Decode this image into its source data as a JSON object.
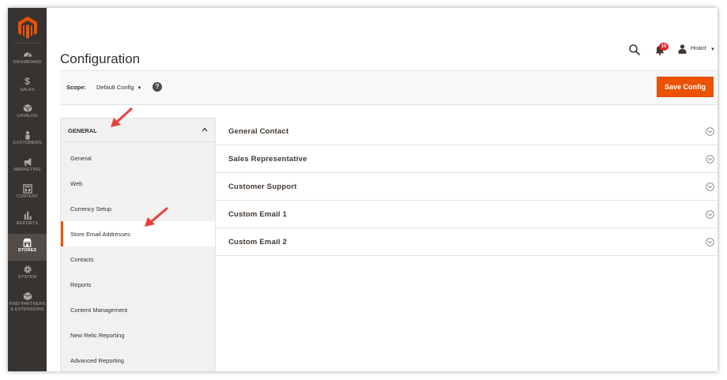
{
  "nav": {
    "items": [
      {
        "label": "Dashboard",
        "icon": "dashboard-icon"
      },
      {
        "label": "Sales",
        "icon": "dollar-icon"
      },
      {
        "label": "Catalog",
        "icon": "cube-icon"
      },
      {
        "label": "Customers",
        "icon": "person-icon"
      },
      {
        "label": "Marketing",
        "icon": "megaphone-icon"
      },
      {
        "label": "Content",
        "icon": "layout-icon"
      },
      {
        "label": "Reports",
        "icon": "bar-chart-icon"
      },
      {
        "label": "Stores",
        "icon": "store-icon"
      },
      {
        "label": "System",
        "icon": "gear-icon"
      },
      {
        "label": "Find Partners",
        "label2": "& Extensions",
        "icon": "box-icon"
      }
    ],
    "active": "Stores"
  },
  "header": {
    "title": "Configuration",
    "notifications_count": "10",
    "user_name": "Hoaict"
  },
  "scope": {
    "label": "Scope:",
    "value": "Default Config",
    "save_label": "Save Config"
  },
  "config_nav": {
    "group_title": "GENERAL",
    "items": [
      "General",
      "Web",
      "Currency Setup",
      "Store Email Addresses",
      "Contacts",
      "Reports",
      "Content Management",
      "New Relic Reporting",
      "Advanced Reporting"
    ],
    "active": "Store Email Addresses"
  },
  "sections": [
    "General Contact",
    "Sales Representative",
    "Customer Support",
    "Custom Email 1",
    "Custom Email 2"
  ],
  "colors": {
    "sidebar": "#373330",
    "accent": "#eb5202",
    "annotation_arrow": "#e8413a"
  }
}
